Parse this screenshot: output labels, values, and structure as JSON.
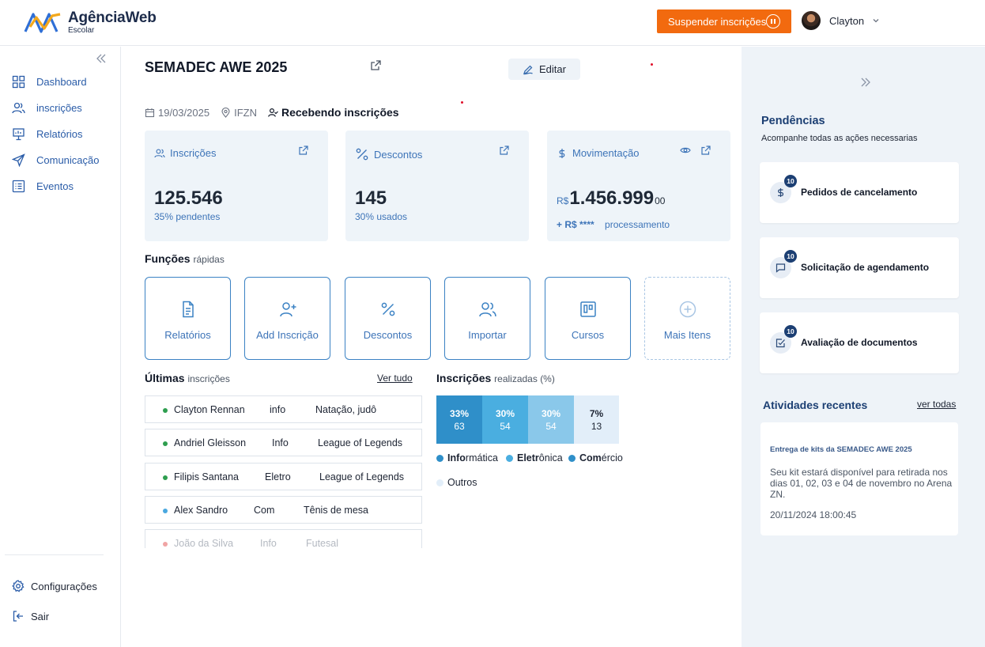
{
  "brand": {
    "name": "AgênciaWeb",
    "subtitle": "Escolar"
  },
  "header": {
    "suspend_label": "Suspender inscrições",
    "user_name": "Clayton"
  },
  "sidebar": {
    "items": [
      {
        "label": "Dashboard",
        "icon": "grid-icon"
      },
      {
        "label": "inscrições",
        "icon": "users-icon"
      },
      {
        "label": "Relatórios",
        "icon": "presentation-icon"
      },
      {
        "label": "Comunicação",
        "icon": "send-icon"
      },
      {
        "label": "Eventos",
        "icon": "list-icon"
      }
    ],
    "bottom": [
      {
        "label": "Configurações",
        "icon": "gear-icon"
      },
      {
        "label": "Sair",
        "icon": "logout-icon"
      }
    ]
  },
  "event": {
    "title": "SEMADEC AWE 2025",
    "edit_label": "Editar",
    "date": "19/03/2025",
    "location": "IFZN",
    "status": "Recebendo inscrições"
  },
  "stats": {
    "inscricoes": {
      "label": "Inscrições",
      "value": "125.546",
      "sub": "35% pendentes"
    },
    "descontos": {
      "label": "Descontos",
      "value": "145",
      "sub": "30% usados"
    },
    "movimentacao": {
      "label": "Movimentação",
      "currency": "R$",
      "value": "1.456.999",
      "cents": "00",
      "pending_value": "+ R$ ****",
      "pending_label": "processamento"
    }
  },
  "quick": {
    "title_bold": "Funções",
    "title_rest": "rápidas",
    "items": [
      {
        "label": "Relatórios",
        "icon": "file-text-icon"
      },
      {
        "label": "Add Inscrição",
        "icon": "user-plus-icon"
      },
      {
        "label": "Descontos",
        "icon": "percent-icon"
      },
      {
        "label": "Importar",
        "icon": "users-icon"
      },
      {
        "label": "Cursos",
        "icon": "kanban-icon"
      },
      {
        "label": "Mais Itens",
        "icon": "plus-circle-icon"
      }
    ]
  },
  "recent": {
    "title_bold": "Últimas",
    "title_rest": "inscrições",
    "see_all": "Ver tudo",
    "rows": [
      {
        "name": "Clayton Rennan",
        "course": "info",
        "activities": "Natação, judô",
        "dot": "#2e9e4f"
      },
      {
        "name": "Andriel Gleisson",
        "course": "Info",
        "activities": "League of Legends",
        "dot": "#2e9e4f"
      },
      {
        "name": "Filipis Santana",
        "course": "Eletro",
        "activities": "League of Legends",
        "dot": "#2e9e4f"
      },
      {
        "name": "Alex Sandro",
        "course": "Com",
        "activities": "Tênis de mesa",
        "dot": "#4aa8e0"
      },
      {
        "name": "João da Silva",
        "course": "Info",
        "activities": "Futesal",
        "dot": "#f0a4a4"
      }
    ]
  },
  "chart_data": {
    "type": "bar",
    "title_bold": "Inscrições",
    "title_rest": "realizadas (%)",
    "categories": [
      "Informática",
      "Eletrônica",
      "Comércio",
      "Outros"
    ],
    "percent_labels": [
      "33%",
      "30%",
      "30%",
      "7%"
    ],
    "values": [
      63,
      54,
      54,
      13
    ],
    "colors": [
      "#2f8fc9",
      "#4aaee0",
      "#8ac8ea",
      "#e2eef9"
    ],
    "legend": [
      {
        "bold": "Info",
        "rest": "rmática"
      },
      {
        "bold": "Eletr",
        "rest": "ônica"
      },
      {
        "bold": "Com",
        "rest": "ércio"
      },
      {
        "bold": "",
        "rest": "Outros"
      }
    ]
  },
  "pendencias": {
    "title": "Pendências",
    "subtitle": "Acompanhe todas as ações necessarias",
    "items": [
      {
        "label": "Pedidos de cancelamento",
        "count": "10",
        "icon": "dollar-icon"
      },
      {
        "label": "Solicitação de agendamento",
        "count": "10",
        "icon": "message-icon"
      },
      {
        "label": "Avaliação de documentos",
        "count": "10",
        "icon": "checkbox-icon"
      }
    ]
  },
  "activities": {
    "title": "Atividades recentes",
    "see_all": "ver todas",
    "card": {
      "title": "Entrega de kits da SEMADEC AWE 2025",
      "body": "Seu kit estará disponível para retirada nos dias 01, 02, 03 e 04 de novembro no Arena ZN.",
      "date": "20/11/2024 18:00:45"
    }
  }
}
